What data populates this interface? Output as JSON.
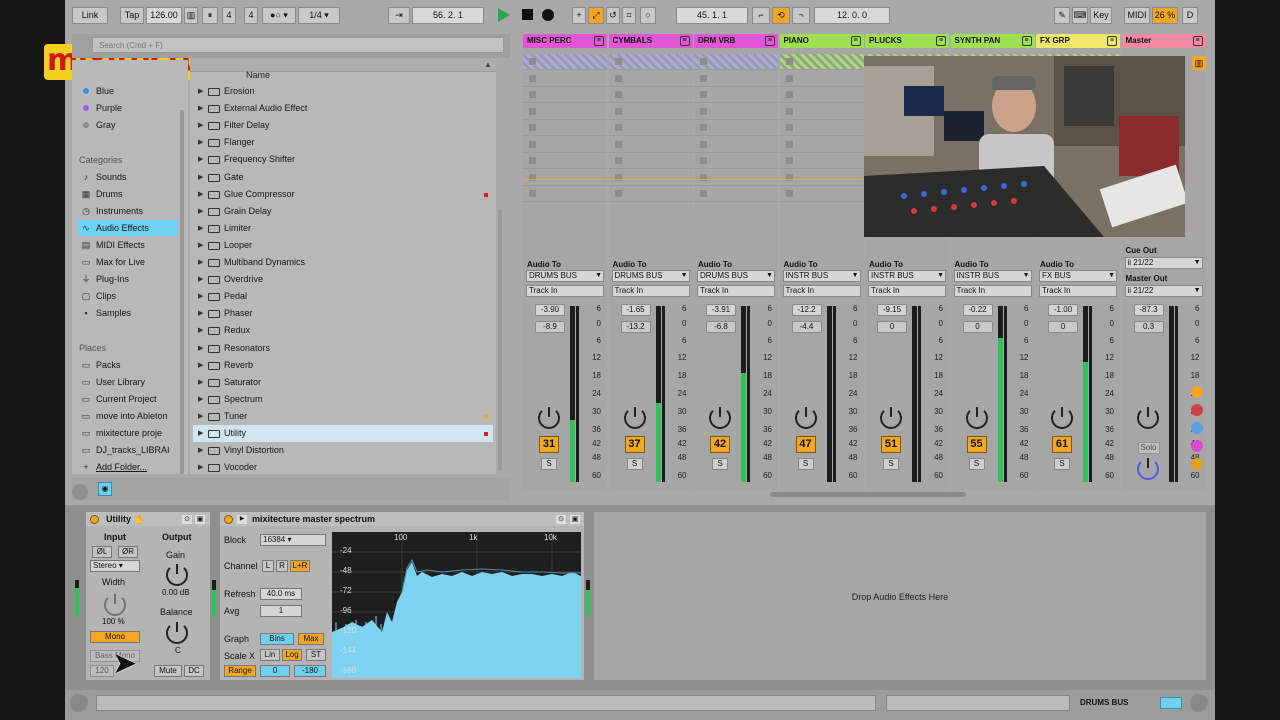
{
  "brand": {
    "logo_text": "mixitecture"
  },
  "transport": {
    "link": "Link",
    "tap": "Tap",
    "tempo": "126.00",
    "sig_num": "4",
    "sig_den": "4",
    "quant": "1/4",
    "position": "56.  2.  1",
    "loop_start": "45.  1.  1",
    "loop_len": "12.  0.  0",
    "key": "Key",
    "midi": "MIDI",
    "cpu": "26 %",
    "d": "D"
  },
  "browser": {
    "search_placeholder": "Search (Cmd + F)",
    "name_header": "Name",
    "colors": [
      {
        "label": "Blue",
        "color": "#3a8fe0"
      },
      {
        "label": "Purple",
        "color": "#a35be0"
      },
      {
        "label": "Gray",
        "color": "#8d8d8d"
      }
    ],
    "categories_title": "Categories",
    "categories": [
      {
        "label": "Sounds",
        "icon": "speaker-icon"
      },
      {
        "label": "Drums",
        "icon": "drum-grid-icon"
      },
      {
        "label": "Instruments",
        "icon": "clock-icon"
      },
      {
        "label": "Audio Effects",
        "icon": "waveform-icon"
      },
      {
        "label": "MIDI Effects",
        "icon": "midi-icon"
      },
      {
        "label": "Max for Live",
        "icon": "max-icon"
      },
      {
        "label": "Plug-Ins",
        "icon": "plug-icon"
      },
      {
        "label": "Clips",
        "icon": "clip-icon"
      },
      {
        "label": "Samples",
        "icon": "sample-icon"
      }
    ],
    "places_title": "Places",
    "places": [
      {
        "label": "Packs",
        "icon": "folder-icon"
      },
      {
        "label": "User Library",
        "icon": "folder-icon"
      },
      {
        "label": "Current Project",
        "icon": "folder-icon"
      },
      {
        "label": "move into Ableton",
        "icon": "folder-icon"
      },
      {
        "label": "mixitecture proje",
        "icon": "folder-icon"
      },
      {
        "label": "DJ_tracks_LIBRAI",
        "icon": "folder-icon"
      },
      {
        "label": "Add Folder...",
        "icon": "plus-icon"
      }
    ],
    "effects": [
      {
        "label": "Erosion",
        "mark": ""
      },
      {
        "label": "External Audio Effect",
        "mark": ""
      },
      {
        "label": "Filter Delay",
        "mark": ""
      },
      {
        "label": "Flanger",
        "mark": ""
      },
      {
        "label": "Frequency Shifter",
        "mark": ""
      },
      {
        "label": "Gate",
        "mark": ""
      },
      {
        "label": "Glue Compressor",
        "mark": "#e02020"
      },
      {
        "label": "Grain Delay",
        "mark": ""
      },
      {
        "label": "Limiter",
        "mark": ""
      },
      {
        "label": "Looper",
        "mark": ""
      },
      {
        "label": "Multiband Dynamics",
        "mark": ""
      },
      {
        "label": "Overdrive",
        "mark": ""
      },
      {
        "label": "Pedal",
        "mark": ""
      },
      {
        "label": "Phaser",
        "mark": ""
      },
      {
        "label": "Redux",
        "mark": ""
      },
      {
        "label": "Resonators",
        "mark": ""
      },
      {
        "label": "Reverb",
        "mark": ""
      },
      {
        "label": "Saturator",
        "mark": ""
      },
      {
        "label": "Spectrum",
        "mark": ""
      },
      {
        "label": "Tuner",
        "mark": "#f5a623"
      },
      {
        "label": "Utility",
        "mark": "#e02020"
      },
      {
        "label": "Vinyl Distortion",
        "mark": ""
      },
      {
        "label": "Vocoder",
        "mark": ""
      }
    ],
    "selected_effect": "Utility"
  },
  "mixer": {
    "audio_to_label": "Audio To",
    "track_in": "Track In",
    "tracks": [
      {
        "name": "MISC PERC",
        "color": "#e056d4",
        "route": "DRUMS BUS",
        "vol": "-3.90",
        "peak": "-8.9",
        "num": "31",
        "level": 0.35
      },
      {
        "name": "CYMBALS",
        "color": "#e056d4",
        "route": "DRUMS BUS",
        "vol": "-1.65",
        "peak": "-13.2",
        "num": "37",
        "level": 0.45
      },
      {
        "name": "DRM VRB",
        "color": "#e056d4",
        "route": "DRUMS BUS",
        "vol": "-3.91",
        "peak": "-6.8",
        "num": "42",
        "level": 0.62
      },
      {
        "name": "PIANO",
        "color": "#9ee052",
        "route": "INSTR BUS",
        "vol": "-12.2",
        "peak": "-4.4",
        "num": "47",
        "level": 0.0
      },
      {
        "name": "PLUCKS",
        "color": "#9ee052",
        "route": "INSTR BUS",
        "vol": "-9.15",
        "peak": "0",
        "num": "51",
        "level": 0.0
      },
      {
        "name": "SYNTH PAN",
        "color": "#9ee052",
        "route": "INSTR BUS",
        "vol": "-0.22",
        "peak": "0",
        "num": "55",
        "level": 0.82
      },
      {
        "name": "FX GRP",
        "color": "#ede86a",
        "route": "FX BUS",
        "vol": "-1.00",
        "peak": "0",
        "num": "61",
        "level": 0.68
      }
    ],
    "master": {
      "name": "Master",
      "color": "#f28aa6",
      "cue_label": "Cue Out",
      "cue_value": "ii 21/22",
      "out_label": "Master Out",
      "out_value": "ii 21/22",
      "vol": "-87.3",
      "peak": "0.3",
      "solo": "Solo"
    },
    "scale_ticks": [
      "6",
      "0",
      "6",
      "12",
      "18",
      "24",
      "30",
      "36",
      "42",
      "48",
      "60"
    ]
  },
  "utility": {
    "title": "Utility",
    "input_label": "Input",
    "output_label": "Output",
    "phase_l": "ØL",
    "phase_r": "ØR",
    "stereo": "Stereo",
    "width_label": "Width",
    "width_value": "100 %",
    "gain_label": "Gain",
    "gain_value": "0.00 dB",
    "balance_label": "Balance",
    "balance_value": "C",
    "mono": "Mono",
    "bass_mono": "Bass Mono",
    "freq": "120",
    "mute": "Mute",
    "dc": "DC"
  },
  "spectrum": {
    "title": "mixitecture master spectrum",
    "block_label": "Block",
    "block_value": "16384",
    "channel_label": "Channel",
    "ch_l": "L",
    "ch_r": "R",
    "ch_lr": "L+R",
    "refresh_label": "Refresh",
    "refresh_value": "40.0 ms",
    "avg_label": "Avg",
    "avg_value": "1",
    "graph_label": "Graph",
    "bins": "Bins",
    "max": "Max",
    "scalex_label": "Scale X",
    "lin": "Lin",
    "log": "Log",
    "st": "ST",
    "range": "Range",
    "range_min": "0",
    "range_max": "-180",
    "freq_labels": [
      "100",
      "1k",
      "10k"
    ],
    "db_labels": [
      "-24",
      "-48",
      "-72",
      "-96",
      "-120",
      "-144",
      "-168"
    ]
  },
  "drop_zone": "Drop Audio Effects Here",
  "status": {
    "bus": "DRUMS BUS"
  }
}
